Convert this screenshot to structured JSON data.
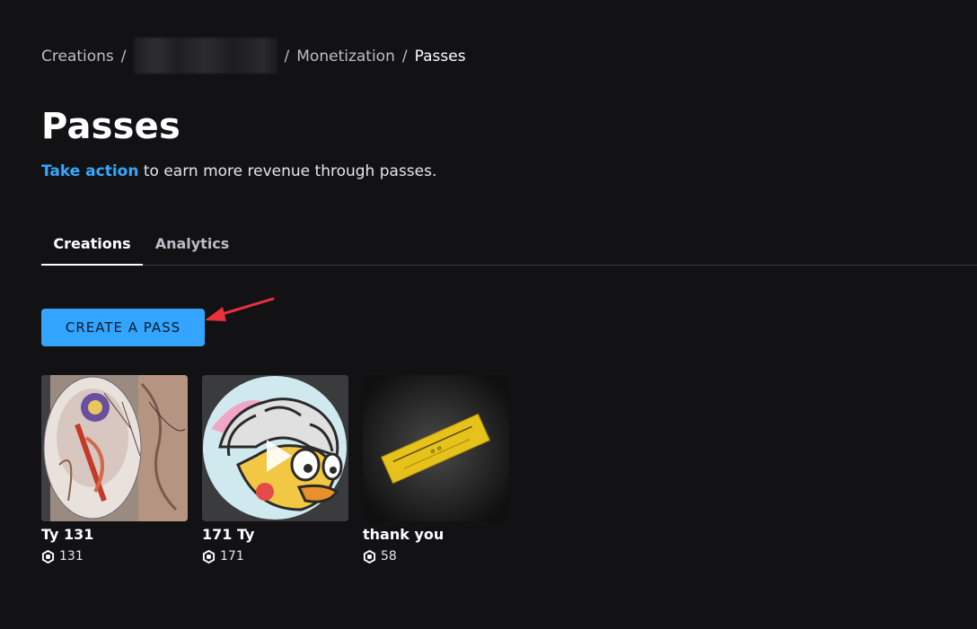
{
  "breadcrumb": {
    "items": [
      "Creations",
      "Monetization",
      "Passes"
    ],
    "separator": "/"
  },
  "page": {
    "title": "Passes",
    "subtitle_link": "Take action",
    "subtitle_rest": " to earn more revenue through passes."
  },
  "tabs": [
    {
      "label": "Creations",
      "active": true
    },
    {
      "label": "Analytics",
      "active": false
    }
  ],
  "create_button": {
    "label": "CREATE A PASS"
  },
  "passes": [
    {
      "name": "Ty 131",
      "price": "131",
      "currency_icon": "robux-icon"
    },
    {
      "name": "171 Ty",
      "price": "171",
      "currency_icon": "robux-icon"
    },
    {
      "name": "thank you",
      "price": "58",
      "currency_icon": "robux-icon"
    }
  ],
  "colors": {
    "background": "#121215",
    "accent": "#33a4ff",
    "link": "#35a9ff",
    "annotation": "#e8313a"
  }
}
